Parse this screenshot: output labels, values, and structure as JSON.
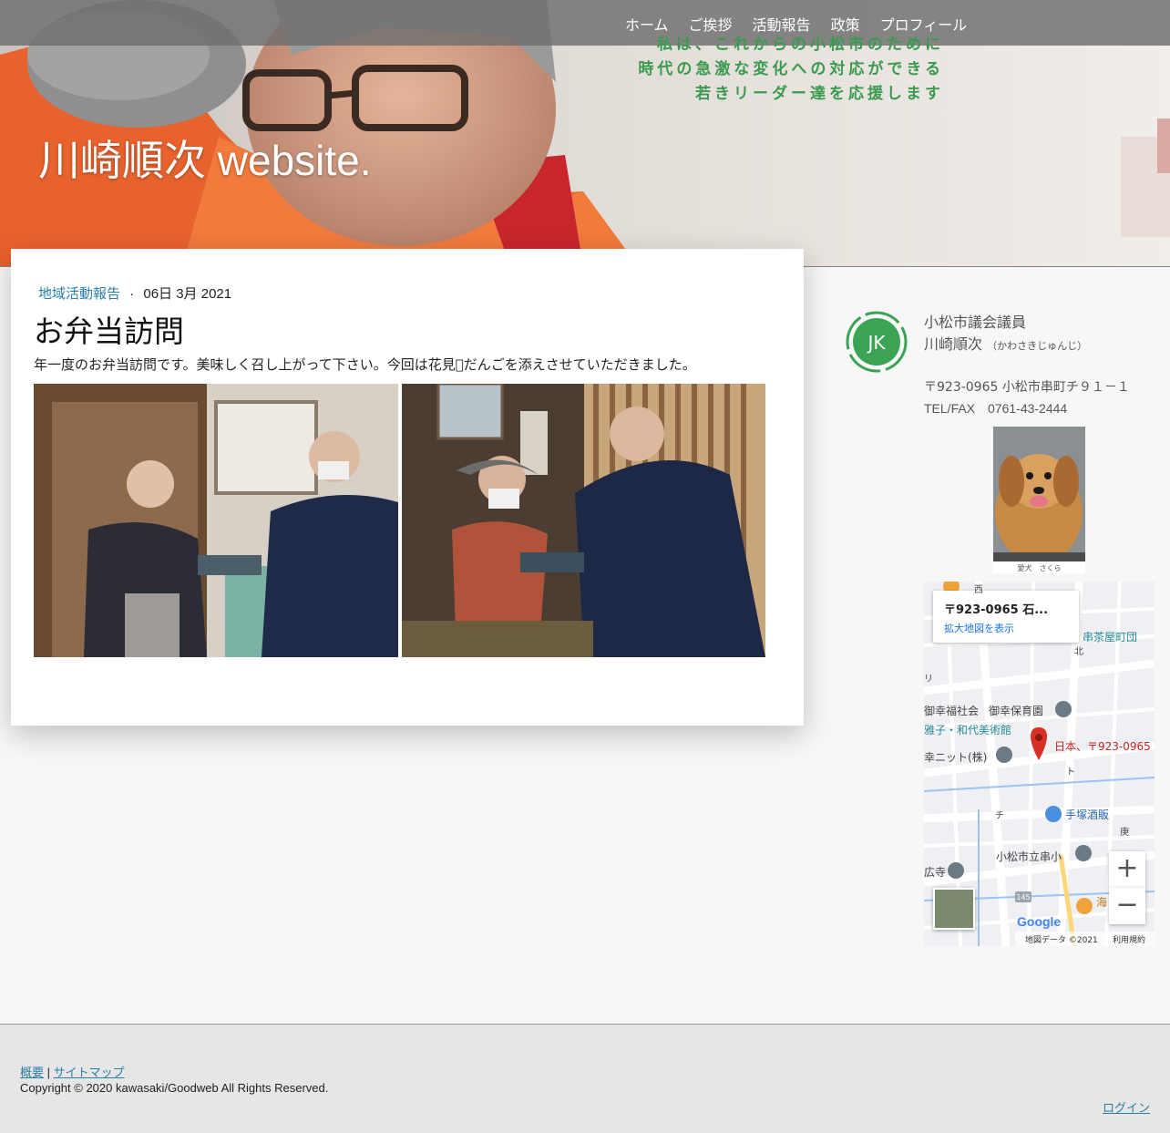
{
  "header": {
    "site_title": "川崎順次 website.",
    "slogan": [
      "私は、これからの小松市のために",
      "時代の急激な変化への対応ができる",
      "若きリーダー達を応援します"
    ],
    "nav": [
      {
        "label": "ホーム"
      },
      {
        "label": "ご挨拶"
      },
      {
        "label": "活動報告"
      },
      {
        "label": "政策"
      },
      {
        "label": "プロフィール"
      }
    ]
  },
  "post": {
    "category": "地域活動報告",
    "separator": "·",
    "date": "06日 3月 2021",
    "title": "お弁当訪問",
    "body": "年一度のお弁当訪問です。美味しく召し上がって下さい。今回は花見\u0000だんごを添えさせていただきました。"
  },
  "sidebar": {
    "logo_text": "JK",
    "role": "小松市議会議員",
    "name": "川崎順次",
    "name_reading": "（かわさきじゅんじ）",
    "address": "〒923-0965 小松市串町チ９１－１",
    "tel": "TEL/FAX　0761-43-2444",
    "dog_caption": "愛犬　さくら"
  },
  "map": {
    "address_short": "〒923-0965 石...",
    "enlarge_link": "拡大地図を表示",
    "pin_label": "日本、〒923-0965",
    "labels": {
      "l1": "串茶屋町団",
      "l2": "御幸福社会",
      "l3": "御幸保育園",
      "l4": "雅子・和代美術館",
      "l5": "幸ニット(株)",
      "l6": "手塚酒販",
      "l7": "小松市立串小",
      "l8": "広寺",
      "l9": "海",
      "l10": "北",
      "l11": "西",
      "l12": "ト",
      "l13": "チ",
      "l14": "庚",
      "l15": "リ"
    },
    "route_number": "145",
    "zoom_in": "+",
    "zoom_out": "−",
    "google": "Google",
    "data_credit": "地図データ ©2021",
    "terms": "利用規約"
  },
  "footer": {
    "link_overview": "概要",
    "link_divider": "|",
    "link_sitemap": "サイトマップ",
    "copyright": "Copyright © 2020 kawasaki/Goodweb All Rights Reserved.",
    "login": "ログイン"
  },
  "colors": {
    "accent_link": "#2a7fa8",
    "slogan_green": "#3a9a4f",
    "logo_green": "#3aa354",
    "map_pin": "#d93025"
  }
}
